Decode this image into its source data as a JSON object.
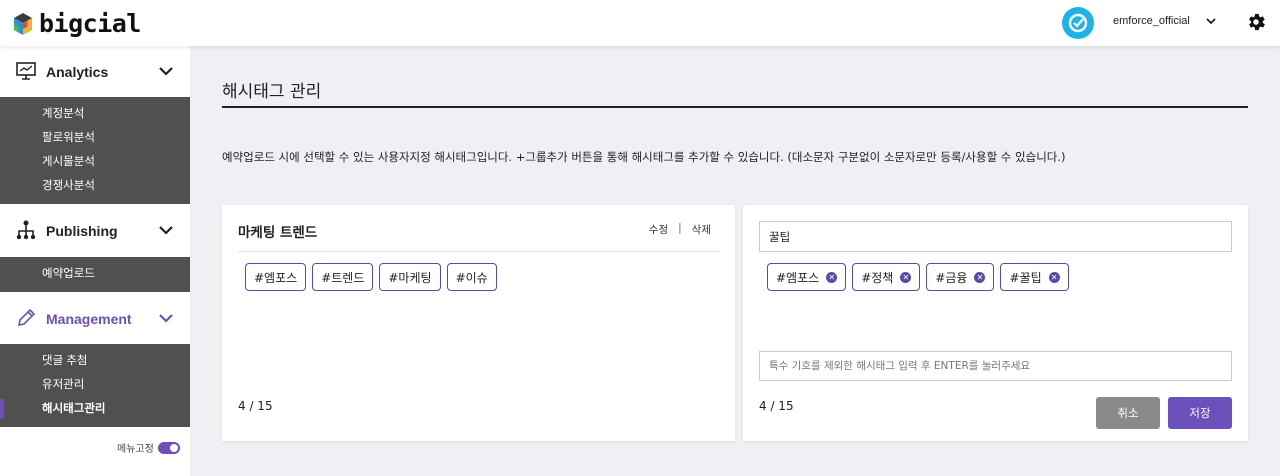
{
  "app": {
    "logo_text": "bigcial",
    "brand_color": "#6b4fbb"
  },
  "header": {
    "username": "emforce_official",
    "icons": [
      "user-avatar-icon",
      "chevron-down-icon",
      "gear-icon"
    ]
  },
  "sidebar": {
    "sections": [
      {
        "label": "Analytics",
        "icon": "monitor-chart-icon",
        "items": [
          {
            "label": "계정분석"
          },
          {
            "label": "팔로워분석"
          },
          {
            "label": "게시물분석"
          },
          {
            "label": "경쟁사분석"
          }
        ]
      },
      {
        "label": "Publishing",
        "icon": "network-icon",
        "items": [
          {
            "label": "예약업로드"
          }
        ]
      },
      {
        "label": "Management",
        "icon": "pencil-icon",
        "items": [
          {
            "label": "댓글 추첨"
          },
          {
            "label": "유저관리"
          },
          {
            "label": "해시태그관리"
          }
        ]
      }
    ],
    "active_item": "해시태그관리",
    "menu_pin_label": "메뉴고정"
  },
  "main": {
    "title": "해시태그 관리",
    "description": "예약업로드 시에 선택할 수 있는 사용자지정 해시태그입니다. +그룹추가 버튼을 통해 해시태그를 추가할 수 있습니다. (대소문자 구분없이 소문자로만 등록/사용할 수 있습니다.)",
    "groups": [
      {
        "name": "마케팅 트렌드",
        "edit_label": "수정",
        "separator": "|",
        "delete_label": "삭제",
        "tags": [
          "#엠포스",
          "#트렌드",
          "#마케팅",
          "#이슈"
        ],
        "count": "4 / 15"
      }
    ],
    "editor": {
      "group_name": "꿀팁",
      "tags": [
        "#엠포스",
        "#정책",
        "#금융",
        "#꿀팁"
      ],
      "input_placeholder": "특수 기호를 제외한 해시태그 입력 후 ENTER를 눌러주세요",
      "count": "4 / 15",
      "cancel_label": "취소",
      "save_label": "저장"
    }
  }
}
